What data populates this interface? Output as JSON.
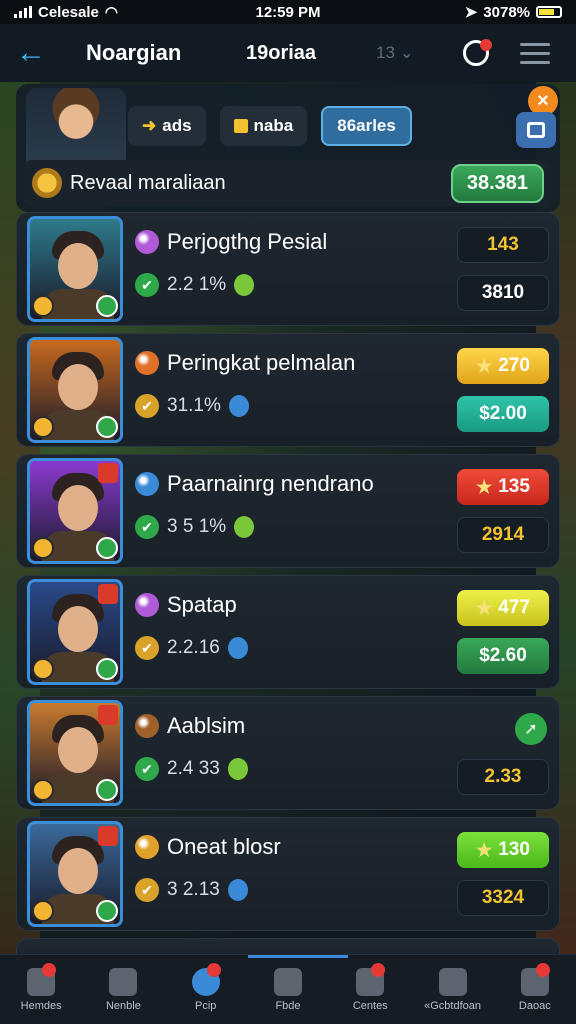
{
  "statusbar": {
    "carrier": "Celesale",
    "time": "12:59 PM",
    "battery": "3078%"
  },
  "header": {
    "title": "Noargian",
    "subtitle": "19oriaa",
    "count": "13"
  },
  "summary": {
    "tabs": [
      {
        "icon": "bolt-icon",
        "label": "ads"
      },
      {
        "icon": "box-icon",
        "label": "naba"
      },
      {
        "icon": "",
        "label": "86arles"
      }
    ],
    "label": "Revaal maraliaan",
    "value": "38.381"
  },
  "rows": [
    {
      "name": "Perjogthg Pesial",
      "stat": "2.2 1%",
      "top": "143",
      "bottom": "3810",
      "top_style": "dark",
      "bottom_style": "darkw",
      "gem_color": "#b05ad8",
      "portrait_bg": "#2e7a8a"
    },
    {
      "name": "Peringkat pelmalan",
      "stat": "31.1%",
      "top": "270",
      "bottom": "$2.00",
      "top_style": "gold",
      "bottom_style": "teal",
      "gem_color": "#e0702a",
      "portrait_bg": "#c86a1e"
    },
    {
      "name": "Paarnainrg nendrano",
      "stat": "3 5 1%",
      "top": "135",
      "bottom": "2914",
      "top_style": "red",
      "bottom_style": "dark",
      "gem_color": "#3a8ad8",
      "portrait_bg": "#8a3ad0"
    },
    {
      "name": "Spatap",
      "stat": "2.2.16",
      "top": "477",
      "bottom": "$2.60",
      "top_style": "lime",
      "bottom_style": "greenbtn",
      "gem_color": "#b05ad8",
      "portrait_bg": "#2a4a8a"
    },
    {
      "name": "Aablsim",
      "stat": "2.4 33",
      "top": "",
      "bottom": "2.33",
      "top_style": "arrow",
      "bottom_style": "dark",
      "gem_color": "#a0602a",
      "portrait_bg": "#c87a2e"
    },
    {
      "name": "Oneat blosr",
      "stat": "3 2.13",
      "top": "130",
      "bottom": "3324",
      "top_style": "green",
      "bottom_style": "dark",
      "gem_color": "#e0a02a",
      "portrait_bg": "#3a6a9a"
    }
  ],
  "bottom_nav": [
    {
      "label": "Hemdes",
      "icon": "home-icon",
      "badge": true
    },
    {
      "label": "Nenble",
      "icon": "search-icon",
      "badge": false
    },
    {
      "label": "Pcip",
      "icon": "compass-icon",
      "badge": true,
      "active": true
    },
    {
      "label": "Fbde",
      "icon": "pin-icon",
      "badge": false
    },
    {
      "label": "Centes",
      "icon": "people-icon",
      "badge": true
    },
    {
      "label": "«Gcbtdfoan",
      "icon": "gamepad-icon",
      "badge": false
    },
    {
      "label": "Daoac",
      "icon": "chat-icon",
      "badge": true
    }
  ]
}
